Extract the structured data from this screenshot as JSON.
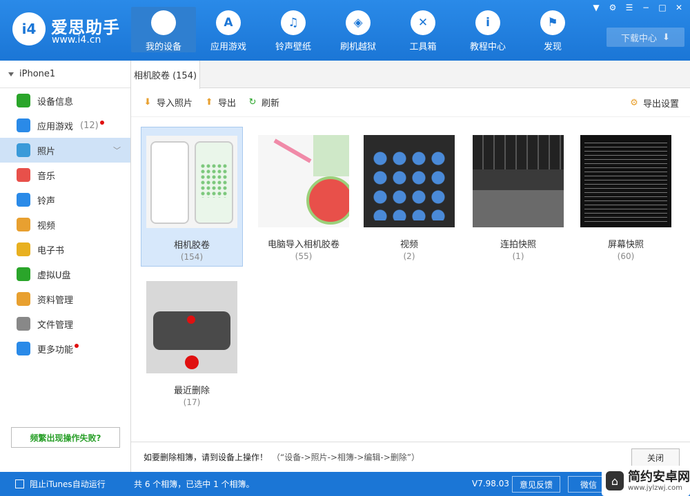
{
  "header": {
    "logo_name": "爱思助手",
    "logo_url": "www.i4.cn",
    "logo_mark": "i4",
    "nav": [
      {
        "label": "我的设备",
        "icon": "apple-icon",
        "glyph": "",
        "active": true
      },
      {
        "label": "应用游戏",
        "icon": "appstore-icon",
        "glyph": "A"
      },
      {
        "label": "铃声壁纸",
        "icon": "music-icon",
        "glyph": "♫"
      },
      {
        "label": "刷机越狱",
        "icon": "dropbox-icon",
        "glyph": "◈"
      },
      {
        "label": "工具箱",
        "icon": "tools-icon",
        "glyph": "✕"
      },
      {
        "label": "教程中心",
        "icon": "info-icon",
        "glyph": "i"
      },
      {
        "label": "发现",
        "icon": "flag-icon",
        "glyph": "⚑"
      }
    ],
    "download_label": "下载中心"
  },
  "sidebar": {
    "device": "iPhone1",
    "items": [
      {
        "label": "设备信息",
        "icon": "info-circle-icon",
        "color": "#2aa52a"
      },
      {
        "label": "应用游戏",
        "count": "(12)",
        "icon": "appstore-icon",
        "color": "#2a8ae8",
        "dot": true
      },
      {
        "label": "照片",
        "icon": "photo-icon",
        "color": "#3a9ad9",
        "active": true
      },
      {
        "label": "音乐",
        "icon": "music-icon",
        "color": "#e8504a"
      },
      {
        "label": "铃声",
        "icon": "bell-icon",
        "color": "#2a8ae8"
      },
      {
        "label": "视频",
        "icon": "film-icon",
        "color": "#e8a030"
      },
      {
        "label": "电子书",
        "icon": "book-icon",
        "color": "#e8b020"
      },
      {
        "label": "虚拟U盘",
        "icon": "usb-icon",
        "color": "#2aa52a"
      },
      {
        "label": "资料管理",
        "icon": "contacts-icon",
        "color": "#e8a030"
      },
      {
        "label": "文件管理",
        "icon": "file-icon",
        "color": "#888888"
      },
      {
        "label": "更多功能",
        "icon": "grid-icon",
        "color": "#2a8ae8",
        "dot": true
      }
    ],
    "fail_button": "频繁出现操作失败?"
  },
  "main": {
    "tab": "相机胶卷 (154)",
    "toolbar": {
      "import": "导入照片",
      "export": "导出",
      "refresh": "刷新",
      "export_settings": "导出设置"
    },
    "albums": [
      {
        "name": "相机胶卷",
        "count": "(154)",
        "selected": true
      },
      {
        "name": "电脑导入相机胶卷",
        "count": "(55)"
      },
      {
        "name": "视频",
        "count": "(2)"
      },
      {
        "name": "连拍快照",
        "count": "(1)"
      },
      {
        "name": "屏幕快照",
        "count": "(60)"
      },
      {
        "name": "最近删除",
        "count": "(17)"
      }
    ],
    "notice_strong": "如要删除相簿，请到设备上操作！",
    "notice_hint": "（“设备->照片->相簿->编辑->删除”）",
    "close": "关闭"
  },
  "status": {
    "itunes": "阻止iTunes自动运行",
    "summary": "共 6 个相簿，已选中 1 个相簿。",
    "version": "V7.98.03",
    "feedback": "意见反馈",
    "wechat": "微信",
    "colors": {
      "bar": "#1b76d6"
    }
  },
  "watermark": {
    "title": "简约安卓网",
    "sub": "www.jylzwj.com"
  }
}
